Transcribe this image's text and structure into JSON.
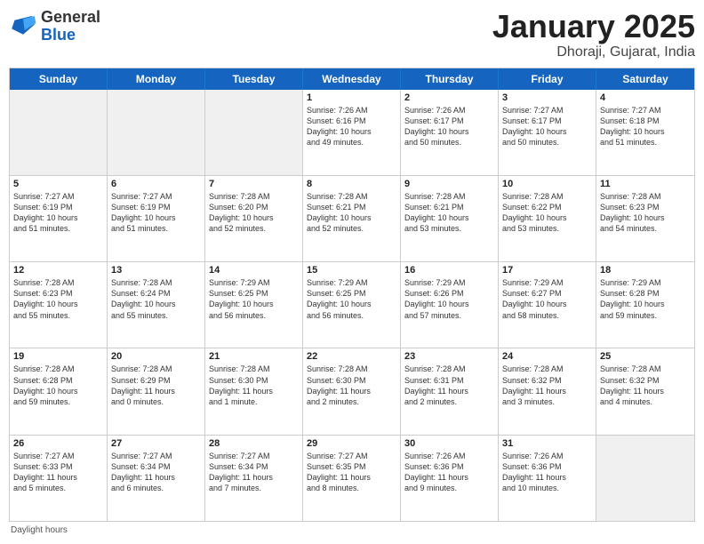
{
  "logo": {
    "general": "General",
    "blue": "Blue"
  },
  "header": {
    "title": "January 2025",
    "subtitle": "Dhoraji, Gujarat, India"
  },
  "days": [
    "Sunday",
    "Monday",
    "Tuesday",
    "Wednesday",
    "Thursday",
    "Friday",
    "Saturday"
  ],
  "footer": {
    "label": "Daylight hours"
  },
  "weeks": [
    {
      "cells": [
        {
          "day": "",
          "info": "",
          "shaded": true
        },
        {
          "day": "",
          "info": "",
          "shaded": true
        },
        {
          "day": "",
          "info": "",
          "shaded": true
        },
        {
          "day": "1",
          "info": "Sunrise: 7:26 AM\nSunset: 6:16 PM\nDaylight: 10 hours\nand 49 minutes."
        },
        {
          "day": "2",
          "info": "Sunrise: 7:26 AM\nSunset: 6:17 PM\nDaylight: 10 hours\nand 50 minutes."
        },
        {
          "day": "3",
          "info": "Sunrise: 7:27 AM\nSunset: 6:17 PM\nDaylight: 10 hours\nand 50 minutes."
        },
        {
          "day": "4",
          "info": "Sunrise: 7:27 AM\nSunset: 6:18 PM\nDaylight: 10 hours\nand 51 minutes."
        }
      ]
    },
    {
      "cells": [
        {
          "day": "5",
          "info": "Sunrise: 7:27 AM\nSunset: 6:19 PM\nDaylight: 10 hours\nand 51 minutes."
        },
        {
          "day": "6",
          "info": "Sunrise: 7:27 AM\nSunset: 6:19 PM\nDaylight: 10 hours\nand 51 minutes."
        },
        {
          "day": "7",
          "info": "Sunrise: 7:28 AM\nSunset: 6:20 PM\nDaylight: 10 hours\nand 52 minutes."
        },
        {
          "day": "8",
          "info": "Sunrise: 7:28 AM\nSunset: 6:21 PM\nDaylight: 10 hours\nand 52 minutes."
        },
        {
          "day": "9",
          "info": "Sunrise: 7:28 AM\nSunset: 6:21 PM\nDaylight: 10 hours\nand 53 minutes."
        },
        {
          "day": "10",
          "info": "Sunrise: 7:28 AM\nSunset: 6:22 PM\nDaylight: 10 hours\nand 53 minutes."
        },
        {
          "day": "11",
          "info": "Sunrise: 7:28 AM\nSunset: 6:23 PM\nDaylight: 10 hours\nand 54 minutes."
        }
      ]
    },
    {
      "cells": [
        {
          "day": "12",
          "info": "Sunrise: 7:28 AM\nSunset: 6:23 PM\nDaylight: 10 hours\nand 55 minutes."
        },
        {
          "day": "13",
          "info": "Sunrise: 7:28 AM\nSunset: 6:24 PM\nDaylight: 10 hours\nand 55 minutes."
        },
        {
          "day": "14",
          "info": "Sunrise: 7:29 AM\nSunset: 6:25 PM\nDaylight: 10 hours\nand 56 minutes."
        },
        {
          "day": "15",
          "info": "Sunrise: 7:29 AM\nSunset: 6:25 PM\nDaylight: 10 hours\nand 56 minutes."
        },
        {
          "day": "16",
          "info": "Sunrise: 7:29 AM\nSunset: 6:26 PM\nDaylight: 10 hours\nand 57 minutes."
        },
        {
          "day": "17",
          "info": "Sunrise: 7:29 AM\nSunset: 6:27 PM\nDaylight: 10 hours\nand 58 minutes."
        },
        {
          "day": "18",
          "info": "Sunrise: 7:29 AM\nSunset: 6:28 PM\nDaylight: 10 hours\nand 59 minutes."
        }
      ]
    },
    {
      "cells": [
        {
          "day": "19",
          "info": "Sunrise: 7:28 AM\nSunset: 6:28 PM\nDaylight: 10 hours\nand 59 minutes."
        },
        {
          "day": "20",
          "info": "Sunrise: 7:28 AM\nSunset: 6:29 PM\nDaylight: 11 hours\nand 0 minutes."
        },
        {
          "day": "21",
          "info": "Sunrise: 7:28 AM\nSunset: 6:30 PM\nDaylight: 11 hours\nand 1 minute."
        },
        {
          "day": "22",
          "info": "Sunrise: 7:28 AM\nSunset: 6:30 PM\nDaylight: 11 hours\nand 2 minutes."
        },
        {
          "day": "23",
          "info": "Sunrise: 7:28 AM\nSunset: 6:31 PM\nDaylight: 11 hours\nand 2 minutes."
        },
        {
          "day": "24",
          "info": "Sunrise: 7:28 AM\nSunset: 6:32 PM\nDaylight: 11 hours\nand 3 minutes."
        },
        {
          "day": "25",
          "info": "Sunrise: 7:28 AM\nSunset: 6:32 PM\nDaylight: 11 hours\nand 4 minutes."
        }
      ]
    },
    {
      "cells": [
        {
          "day": "26",
          "info": "Sunrise: 7:27 AM\nSunset: 6:33 PM\nDaylight: 11 hours\nand 5 minutes."
        },
        {
          "day": "27",
          "info": "Sunrise: 7:27 AM\nSunset: 6:34 PM\nDaylight: 11 hours\nand 6 minutes."
        },
        {
          "day": "28",
          "info": "Sunrise: 7:27 AM\nSunset: 6:34 PM\nDaylight: 11 hours\nand 7 minutes."
        },
        {
          "day": "29",
          "info": "Sunrise: 7:27 AM\nSunset: 6:35 PM\nDaylight: 11 hours\nand 8 minutes."
        },
        {
          "day": "30",
          "info": "Sunrise: 7:26 AM\nSunset: 6:36 PM\nDaylight: 11 hours\nand 9 minutes."
        },
        {
          "day": "31",
          "info": "Sunrise: 7:26 AM\nSunset: 6:36 PM\nDaylight: 11 hours\nand 10 minutes."
        },
        {
          "day": "",
          "info": "",
          "shaded": true
        }
      ]
    }
  ]
}
